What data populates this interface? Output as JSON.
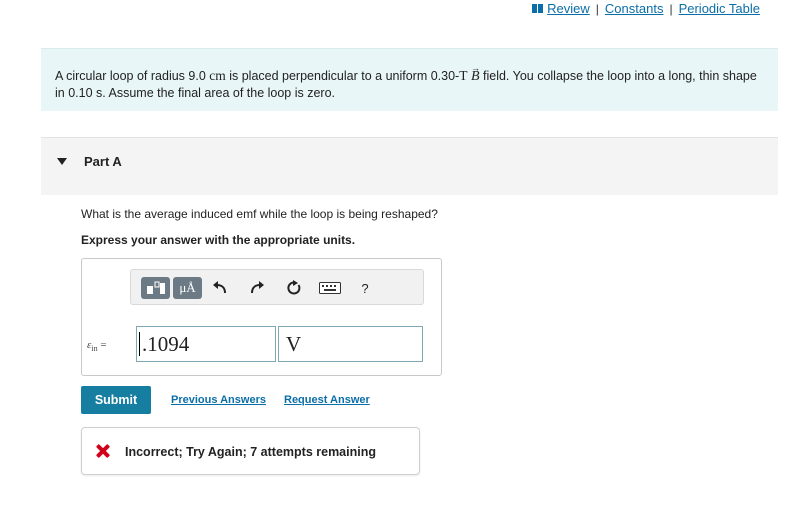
{
  "top_links": {
    "review": "Review",
    "constants": "Constants",
    "periodic_table": "Periodic Table",
    "separator": "|"
  },
  "problem": {
    "part1": "A circular loop of radius 9.0 ",
    "unit_cm": "cm",
    "part2": " is placed perpendicular to a uniform 0.30-",
    "unit_T": "T",
    "symbol_B": "B",
    "part3": " field. You collapse the loop into a long, thin shape in 0.10 s. Assume the final area of the loop is zero."
  },
  "part": {
    "title": "Part A"
  },
  "question": {
    "text": "What is the average induced emf while the loop is being reshaped?",
    "instruction": "Express your answer with the appropriate units."
  },
  "toolbar": {
    "units_label": "μÅ",
    "help_label": "?",
    "icons": [
      "template-icon",
      "units-icon",
      "undo-icon",
      "redo-icon",
      "reset-icon",
      "keyboard-icon",
      "help-icon"
    ]
  },
  "answer": {
    "label_symbol": "ε",
    "label_sub": "in",
    "label_eq": " =",
    "value": ".1094",
    "unit": "V"
  },
  "actions": {
    "submit": "Submit",
    "previous_answers": "Previous Answers",
    "request_answer": "Request Answer"
  },
  "feedback": {
    "message": "Incorrect; Try Again; 7 attempts remaining",
    "status_color": "#d0021b"
  },
  "colors": {
    "accent": "#167ea0",
    "link": "#0b6ea8",
    "problem_bg": "#e9f6f7",
    "part_bg": "#f4f4f4"
  }
}
